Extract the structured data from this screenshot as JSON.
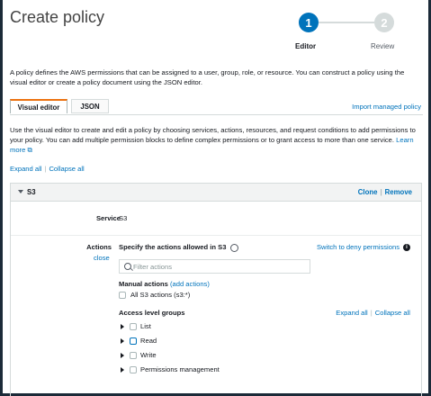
{
  "page_title": "Create policy",
  "steps": [
    {
      "number": "1",
      "label": "Editor"
    },
    {
      "number": "2",
      "label": "Review"
    }
  ],
  "description": "A policy defines the AWS permissions that can be assigned to a user, group, role, or resource. You can construct a policy using the visual editor or create a policy document using the JSON editor.",
  "tabs": {
    "visual": "Visual editor",
    "json": "JSON"
  },
  "import_link": "Import managed policy",
  "intro_text": "Use the visual editor to create and edit a policy by choosing services, actions, resources, and request conditions to add permissions to your policy. You can add multiple permission blocks to define complex permissions or to grant access to more than one service.",
  "learn_more": "Learn more",
  "expand_all": "Expand all",
  "collapse_all": "Collapse all",
  "panel": {
    "service_title": "S3",
    "clone": "Clone",
    "remove": "Remove",
    "service_label": "Service",
    "service_value": "S3",
    "actions_label": "Actions",
    "actions_close": "close",
    "specify_text": "Specify the actions allowed in S3",
    "deny_link": "Switch to deny permissions",
    "filter_placeholder": "Filter actions",
    "manual_title": "Manual actions",
    "add_actions": "(add actions)",
    "all_actions": "All S3 actions (s3:*)",
    "access_title": "Access level groups",
    "expand_all": "Expand all",
    "collapse_all": "Collapse all",
    "levels": [
      "List",
      "Read",
      "Write",
      "Permissions management"
    ]
  }
}
